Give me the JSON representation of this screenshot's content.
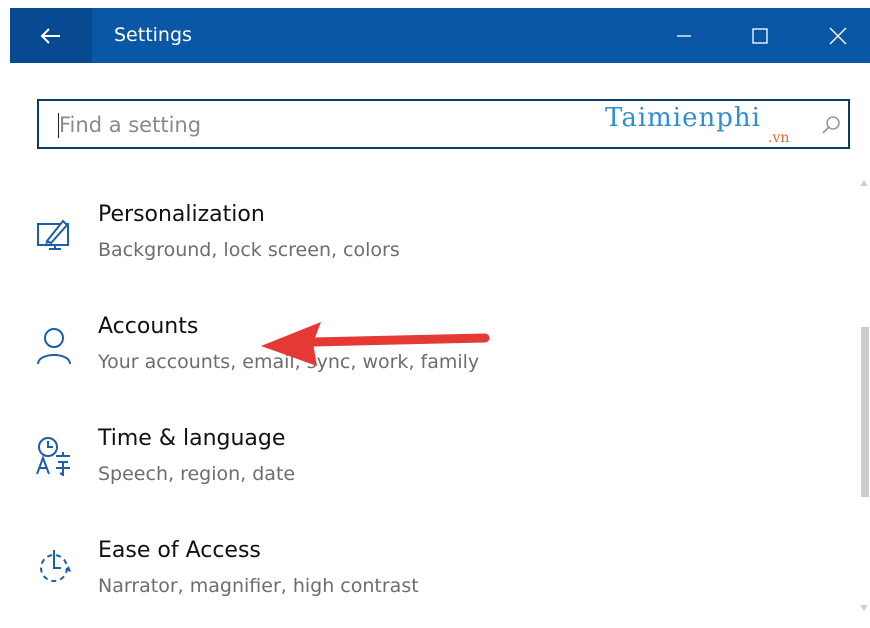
{
  "window": {
    "title": "Settings",
    "buttons": {
      "back": "back-arrow-icon",
      "minimize": "minimize-icon",
      "maximize": "maximize-icon",
      "close": "close-icon"
    }
  },
  "search": {
    "placeholder": "Find a setting",
    "value": "",
    "icon": "search-icon"
  },
  "watermark": {
    "main": "Taimienphi",
    "sub": ".vn"
  },
  "settings": [
    {
      "title": "Personalization",
      "description": "Background, lock screen, colors",
      "icon": "personalization-icon"
    },
    {
      "title": "Accounts",
      "description": "Your accounts, email, sync, work, family",
      "icon": "accounts-icon"
    },
    {
      "title": "Time & language",
      "description": "Speech, region, date",
      "icon": "time-language-icon"
    },
    {
      "title": "Ease of Access",
      "description": "Narrator, magnifier, high contrast",
      "icon": "ease-of-access-icon"
    }
  ],
  "colors": {
    "titlebar": "#0a57a6",
    "back_button": "#074a92",
    "icon_accent": "#1a5fa8",
    "annotation_arrow": "#e53935",
    "search_border": "#0b3d69"
  }
}
